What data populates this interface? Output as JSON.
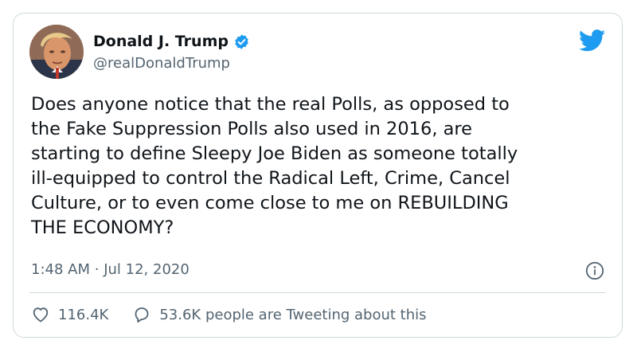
{
  "author": {
    "display_name": "Donald J. Trump",
    "handle": "@realDonaldTrump",
    "verified": true,
    "avatar": "profile-photo"
  },
  "tweet": {
    "text": "Does anyone notice that the real Polls, as opposed to\nthe Fake Suppression Polls also used in 2016, are\nstarting to define Sleepy Joe Biden as someone totally\nill-equipped to control the Radical Left, Crime, Cancel\nCulture, or to even come close to me on REBUILDING\nTHE ECONOMY?",
    "time": "1:48 AM",
    "separator": "·",
    "date": "Jul 12, 2020"
  },
  "actions": {
    "likes": "116.4K",
    "conversation": "53.6K people are Tweeting about this"
  },
  "icons": {
    "brand": "twitter-bird-icon",
    "verified": "verified-badge-icon",
    "info": "info-icon",
    "like": "heart-icon",
    "reply": "speech-bubble-icon"
  },
  "colors": {
    "brand_blue": "#1d9bf0",
    "text_primary": "#0f1419",
    "text_secondary": "#536471",
    "border": "#cfd9de"
  }
}
